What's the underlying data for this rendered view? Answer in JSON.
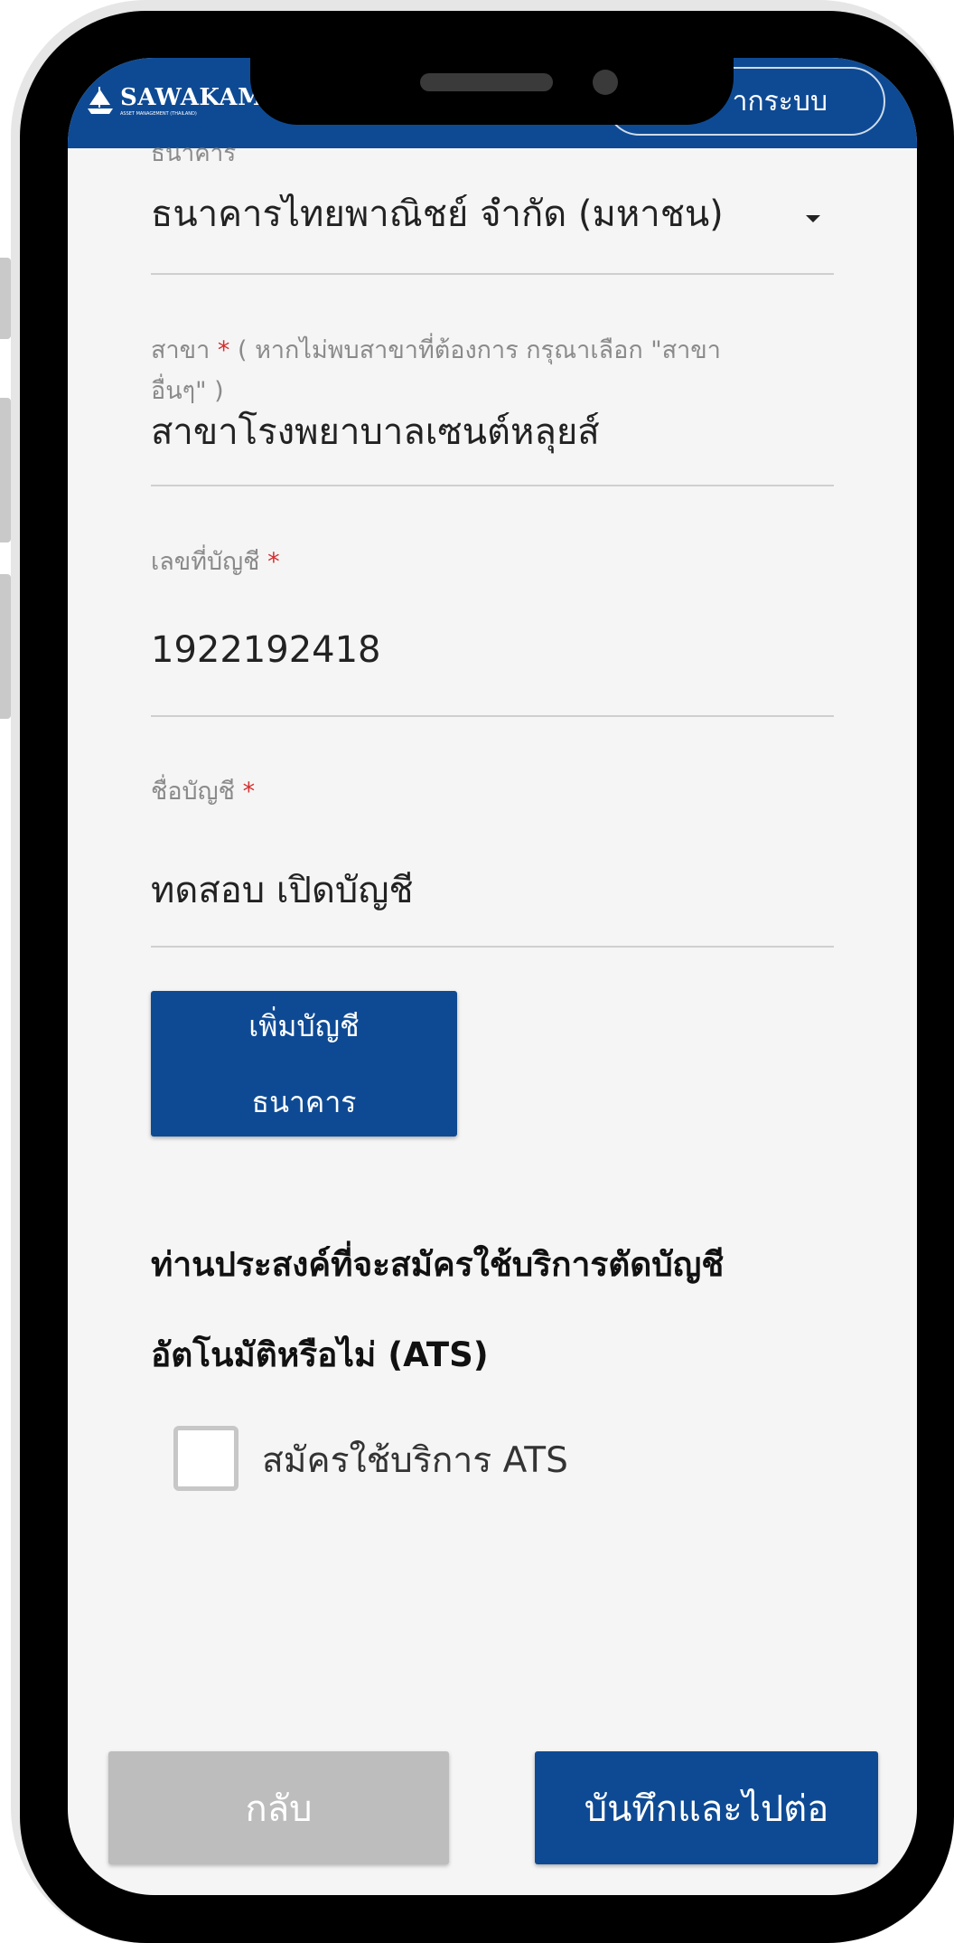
{
  "header": {
    "logo_name": "SAWAKAMI",
    "logo_subtitle": "ASSET MANAGEMENT (THAILAND)",
    "logout_label_visible": "ากระบบ"
  },
  "form": {
    "bank_label_cut": "ธนาคาร",
    "bank_value": "ธนาคารไทยพาณิชย์ จำกัด (มหาชน)",
    "branch_label": "สาขา",
    "branch_hint_line1": "( หากไม่พบสาขาที่ต้องการ กรุณาเลือก \"สาขา",
    "branch_hint_line2": "อื่นๆ\" )",
    "branch_value": "สาขาโรงพยาบาลเซนต์หลุยส์",
    "account_no_label": "เลขที่บัญชี",
    "account_no_value": "1922192418",
    "account_name_label": "ชื่อบัญชี",
    "account_name_value": "ทดสอบ เปิดบัญชี",
    "required_marker": "*",
    "add_bank_label_line1": "เพิ่มบัญชี",
    "add_bank_label_line2": "ธนาคาร"
  },
  "ats": {
    "question_line1": "ท่านประสงค์ที่จะสมัครใช้บริการตัดบัญชี",
    "question_line2": "อัตโนมัติหรือไม่ (ATS)",
    "checkbox_label": "สมัครใช้บริการ ATS",
    "checked": false
  },
  "footer": {
    "back_label": "กลับ",
    "save_label": "บันทึกและไปต่อ"
  },
  "colors": {
    "primary": "#0e4a94",
    "required": "#d32f2f",
    "disabled": "#bdbdbd"
  }
}
